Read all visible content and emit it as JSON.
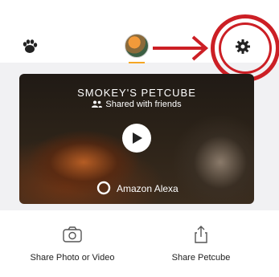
{
  "header": {
    "left_icon": "paw-icon",
    "avatar": "pet-avatar",
    "right_icon": "gear-icon",
    "annotation": {
      "arrow_color": "#cc1f25",
      "ring_color": "#cc1f25"
    },
    "accent": "#f5a623"
  },
  "camera_card": {
    "title": "SMOKEY'S PETCUBE",
    "shared_label": "Shared with friends",
    "shared_icon": "people-icon",
    "play_icon": "play-icon",
    "alexa_icon": "alexa-ring-icon",
    "alexa_label": "Amazon Alexa"
  },
  "actions": [
    {
      "label": "Share Photo or Video",
      "icon": "camera-icon"
    },
    {
      "label": "Share Petcube",
      "icon": "share-upload-icon"
    }
  ]
}
